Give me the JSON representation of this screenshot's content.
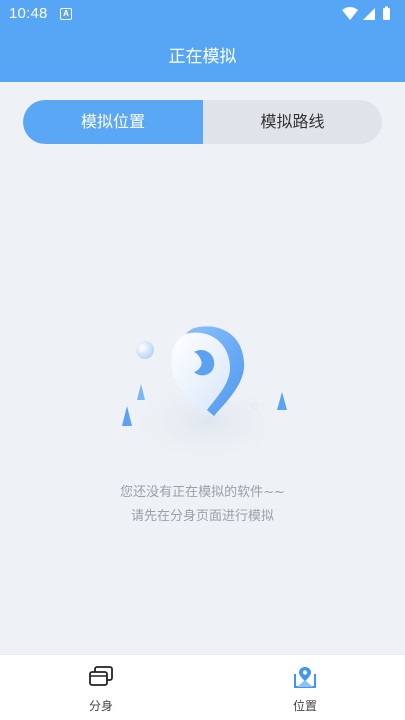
{
  "status_bar": {
    "time": "10:48",
    "notification_letter": "A"
  },
  "app_bar": {
    "title": "正在模拟"
  },
  "tabs": [
    {
      "label": "模拟位置",
      "selected": true
    },
    {
      "label": "模拟路线",
      "selected": false
    }
  ],
  "empty_state": {
    "line1": "您还没有正在模拟的软件~~",
    "line2": "请先在分身页面进行模拟"
  },
  "bottom_nav": [
    {
      "label": "分身",
      "icon": "cards-icon",
      "active": false
    },
    {
      "label": "位置",
      "icon": "map-location-icon",
      "active": true
    }
  ],
  "colors": {
    "accent": "#5aa8f5",
    "background": "#eef1f5",
    "muted_text": "#9aa1ab"
  }
}
